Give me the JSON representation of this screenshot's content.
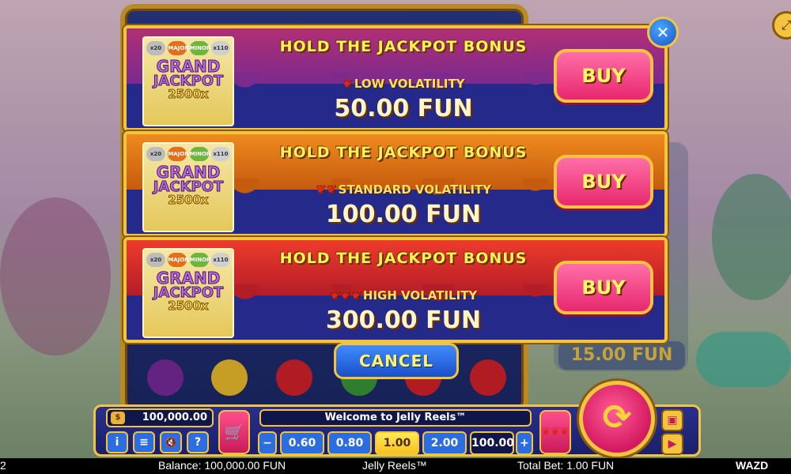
{
  "offers": [
    {
      "title": "HOLD THE JACKPOT BONUS",
      "volatility": "LOW VOLATILITY",
      "chilis": "❦",
      "price": "50.00 FUN",
      "buy_label": "BUY",
      "card": {
        "m1": "x20",
        "m2": "MAJOR",
        "m3": "MINOR",
        "m4": "x110",
        "g1": "GRAND",
        "g2": "JACKPOT",
        "g3": "2500x"
      }
    },
    {
      "title": "HOLD THE JACKPOT BONUS",
      "volatility": "STANDARD VOLATILITY",
      "chilis": "❦❦",
      "price": "100.00 FUN",
      "buy_label": "BUY",
      "card": {
        "m1": "x20",
        "m2": "MAJOR",
        "m3": "MINOR",
        "m4": "x110",
        "g1": "GRAND",
        "g2": "JACKPOT",
        "g3": "2500x"
      }
    },
    {
      "title": "HOLD THE JACKPOT BONUS",
      "volatility": "HIGH VOLATILITY",
      "chilis": "❦❦❦",
      "price": "300.00 FUN",
      "buy_label": "BUY",
      "card": {
        "m1": "x20",
        "m2": "MAJOR",
        "m3": "MINOR",
        "m4": "x110",
        "g1": "GRAND",
        "g2": "JACKPOT",
        "g3": "2500x"
      }
    }
  ],
  "close_label": "✕",
  "cancel_label": "CANCEL",
  "background": {
    "bet_display": "15.00 FUN"
  },
  "panel": {
    "balance": "100,000.00",
    "welcome": "Welcome to Jelly Reels™",
    "bet_minus": "−",
    "bet_plus": "+",
    "bet_options": [
      "0.60",
      "0.80",
      "1.00",
      "2.00"
    ],
    "bet_selected": "1.00",
    "bet_value": "100.00",
    "info_icon": "i",
    "menu_icon": "≡",
    "sound_icon": "🔇",
    "help_icon": "?",
    "cart_icon": "🛒",
    "chili_icon": "❦❦❦",
    "spin_icon": "⟳",
    "autoplay_icon": "▣",
    "turbo_icon": "▶"
  },
  "status_bar": {
    "left": "2",
    "balance": "Balance: 100,000.00 FUN",
    "game_name": "Jelly Reels™",
    "total_bet": "Total Bet: 1.00 FUN",
    "brand": "WAZD"
  },
  "colors": {
    "gold": "#f3c43f",
    "pink_button": "#e8286f",
    "navy": "#25298a"
  }
}
